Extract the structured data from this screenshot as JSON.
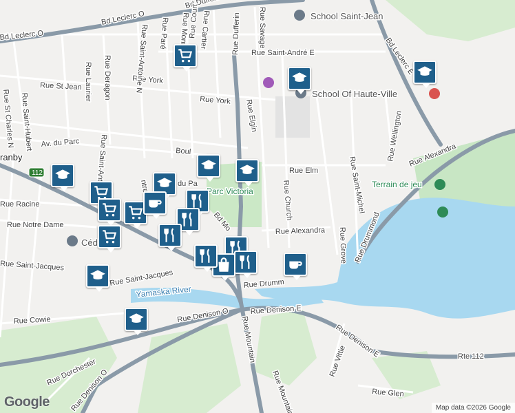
{
  "map": {
    "labels": {
      "bd_leclerc_o": "Bd Leclerc O",
      "bd_leclerc_e": "Bd Leclerc E",
      "bd_dufferin": "Bd Dufferin",
      "rue_dufferin": "Rue Dufferin",
      "rue_saint_andre_e": "Rue Saint-André E",
      "rue_st_jean": "Rue St Jean",
      "rue_york_1": "Rue York",
      "rue_york_2": "Rue York",
      "rue_laurier": "Rue Laurier",
      "rue_deragon": "Rue Deragon",
      "rue_saint_antoine_n_1": "Rue Saint-Antoine N",
      "rue_saint_antoine_n_2": "Rue Saint-Antoine N",
      "rue_pare": "Rue Paré",
      "rue_montcalm": "Rue Montcalm",
      "rue_cartier": "Rue Cartier",
      "rue_court": "Rue Court",
      "rue_savage": "Rue Savage",
      "rue_elgin": "Rue Elgin",
      "rue_st_charles_n": "Rue St Charles N",
      "rue_saint_hubert": "Rue Saint-Hubert",
      "av_du_parc": "Av. du Parc",
      "boul": "Boul",
      "rue_elm": "Rue Elm",
      "rue_church": "Rue Church",
      "rue_saint_michel": "Rue Saint-Michel",
      "rue_wellington": "Rue Wellington",
      "rue_alexandra_e": "Rue Alexandra",
      "rue_alexandra_c": "Rue Alexandra",
      "rue_drummond_v": "Rue Drummond",
      "rue_drummond_h": "Rue Drumm",
      "rue_grove": "Rue Grove",
      "rue_racine": "Rue Racine",
      "rue_notre_dame": "Rue Notre Dame",
      "rue_saint_jacques_1": "Rue Saint-Jacques",
      "rue_saint_jacques_2": "Rue Saint-Jacques",
      "rue_cowie": "Rue Cowie",
      "rue_denison_o_1": "Rue Denison O",
      "rue_denison_o_2": "Rue Denison O",
      "rue_denison_e_1": "Rue Denison E",
      "rue_denison_e_2": "Rue Denison E",
      "rue_mountain_1": "Rue Mountain",
      "rue_mountain_2": "Rue Mountain",
      "rue_dorchester": "Rue Dorchester",
      "rue_vittie": "Rue Vittie",
      "rue_glen": "Rue Glen",
      "rte_112": "Rte 112",
      "route_shield_112": "112",
      "bd_mo": "Bd Mo",
      "du_pa": "du Pa",
      "ntre": "ntre",
      "granby": "ranby",
      "yamaska_river": "Yamaska River",
      "parc_victoria": "Parc Victoria",
      "terrain_de_jeu": "Terrain de jeu",
      "school_saint_jean": "School Saint-Jean",
      "school_of_haute_ville": "School Of Haute-Ville",
      "ced_gran": "Céd  Gran"
    },
    "markers": [
      {
        "type": "shopping-cart",
        "icon": "cart"
      },
      {
        "type": "school",
        "icon": "cap"
      },
      {
        "type": "school",
        "icon": "cap"
      },
      {
        "type": "school",
        "icon": "cap"
      },
      {
        "type": "school",
        "icon": "cap"
      },
      {
        "type": "school",
        "icon": "cap"
      },
      {
        "type": "school",
        "icon": "cap"
      },
      {
        "type": "school",
        "icon": "cap"
      },
      {
        "type": "school",
        "icon": "cap"
      },
      {
        "type": "shopping-cart",
        "icon": "cart"
      },
      {
        "type": "shopping-cart",
        "icon": "cart"
      },
      {
        "type": "shopping-cart",
        "icon": "cart"
      },
      {
        "type": "cafe",
        "icon": "cup"
      },
      {
        "type": "restaurant",
        "icon": "fork-knife"
      },
      {
        "type": "restaurant",
        "icon": "fork-knife"
      },
      {
        "type": "restaurant",
        "icon": "fork-knife"
      },
      {
        "type": "restaurant",
        "icon": "fork-knife"
      },
      {
        "type": "shopping-bag",
        "icon": "bag"
      },
      {
        "type": "cafe",
        "icon": "cup"
      },
      {
        "type": "shopping-cart",
        "icon": "cart"
      },
      {
        "type": "restaurant",
        "icon": "fork-knife"
      },
      {
        "type": "restaurant",
        "icon": "fork-knife"
      }
    ],
    "colors": {
      "land": "#f2f1ef",
      "water": "#a8d8f0",
      "park": "#c8e6c4",
      "major_road": "#8a9aa8",
      "minor_road": "#ffffff",
      "marker": "#1f5f8b"
    }
  },
  "footer": {
    "google_logo": "Google",
    "attribution": "Map data ©2026 Google"
  }
}
